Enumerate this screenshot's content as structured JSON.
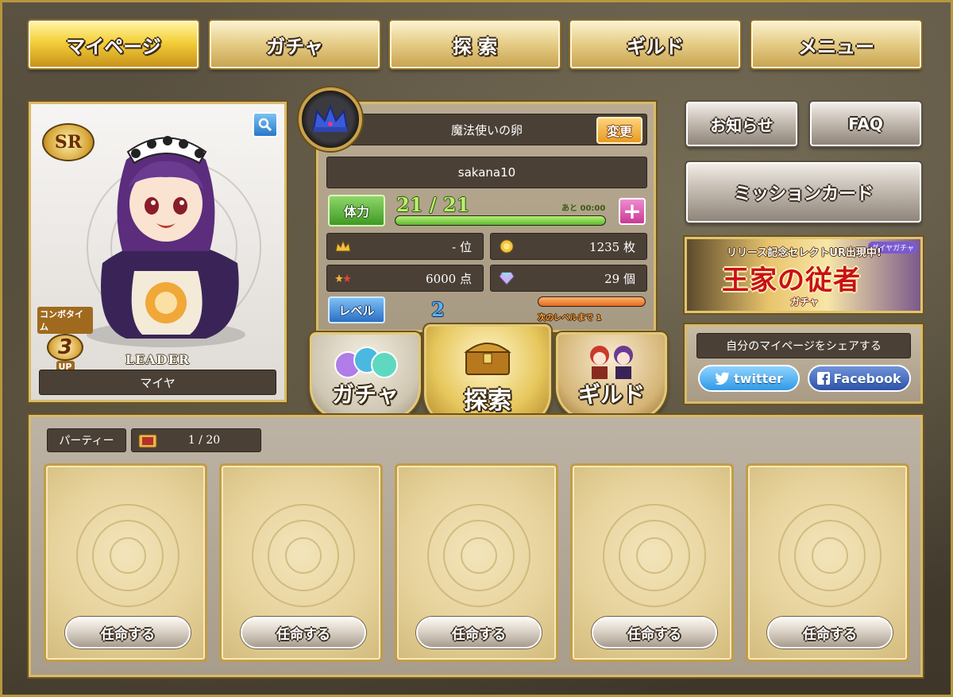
{
  "nav": {
    "items": [
      {
        "label": "マイページ",
        "active": true
      },
      {
        "label": "ガチャ",
        "active": false
      },
      {
        "label": "探 索",
        "active": false
      },
      {
        "label": "ギルド",
        "active": false
      },
      {
        "label": "メニュー",
        "active": false
      }
    ]
  },
  "character": {
    "rarity": "SR",
    "combo_label_top": "コンボタイム",
    "combo_value": "3",
    "combo_label_bottom": "UP",
    "leader_label": "LEADER",
    "name": "マイヤ"
  },
  "profile": {
    "title": "魔法使いの卵",
    "change_label": "変更",
    "username": "sakana10",
    "stamina_label": "体力",
    "stamina_value": "21  /  21",
    "stamina_fraction": 1.0,
    "stamina_timer": "あと 00:00",
    "rank_value": "- 位",
    "coins_value": "1235 枚",
    "points_value": "6000 点",
    "gems_value": "29 個",
    "level_label": "レベル",
    "level_value": "2",
    "next_level_text": "次のレベルまで 1"
  },
  "shields": {
    "gacha": "ガチャ",
    "explore": "探索",
    "guild": "ギルド"
  },
  "right": {
    "news": "お知らせ",
    "faq": "FAQ",
    "mission": "ミッションカード",
    "banner_top": "リリース記念セレクトUR出現中!",
    "banner_title": "王家の従者",
    "banner_sub": "ガチャ",
    "banner_tag": "ダイヤガチャ",
    "share_title": "自分のマイページをシェアする",
    "twitter": "twitter",
    "facebook": "Facebook"
  },
  "party": {
    "tab_label": "パーティー",
    "count": "1 / 20",
    "slots": [
      {
        "button": "任命する"
      },
      {
        "button": "任命する"
      },
      {
        "button": "任命する"
      },
      {
        "button": "任命する"
      },
      {
        "button": "任命する"
      }
    ]
  },
  "colors": {
    "gold_border": "#d8bb6b",
    "stamina_green": "#7ed957",
    "level_orange": "#f08a3c"
  }
}
